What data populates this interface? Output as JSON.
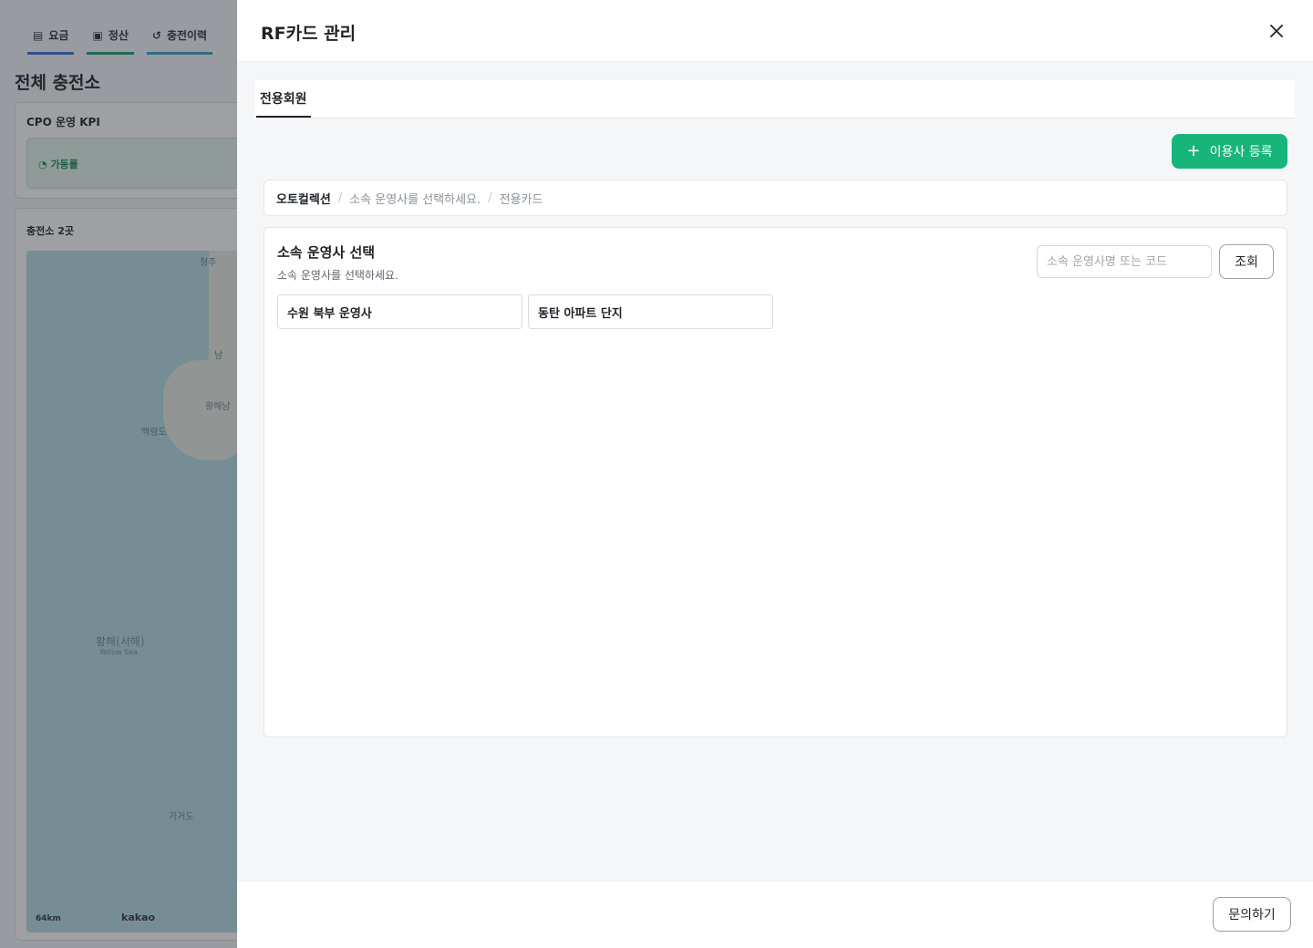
{
  "background": {
    "tabs": [
      {
        "label": "요금",
        "icon": "doc-icon"
      },
      {
        "label": "정산",
        "icon": "wallet-icon"
      },
      {
        "label": "충전이력",
        "icon": "history-icon"
      }
    ],
    "page_title": "전체 충전소",
    "kpi_title": "CPO 운영 KPI",
    "kpi_label": "가동률",
    "map_title": "충전소 2곳",
    "map_labels": [
      "청주",
      "남",
      "황해남",
      "백령도",
      "황해(서해)",
      "Yellow Sea",
      "가거도"
    ],
    "map_scale": "64km",
    "map_brand": "kakao"
  },
  "drawer": {
    "title": "RF카드 관리",
    "tabs": [
      {
        "label": "전용회원",
        "active": true
      }
    ],
    "add_button": "이용사 등록",
    "breadcrumb": {
      "root": "오토컬렉션",
      "items": [
        "소속 운영사를 선택하세요.",
        "전용카드"
      ]
    },
    "panel": {
      "title": "소속 운영사 선택",
      "subtitle": "소속 운영사를 선택하세요.",
      "search_placeholder": "소속 운영사명 또는 코드",
      "search_button": "조회",
      "operators": [
        "수원 북부 운영사",
        "동탄 아파트 단지"
      ]
    },
    "footer": {
      "inquiry_button": "문의하기"
    }
  },
  "colors": {
    "accent_green": "#18b57a",
    "overlay": "rgba(40,44,52,0.45)"
  }
}
